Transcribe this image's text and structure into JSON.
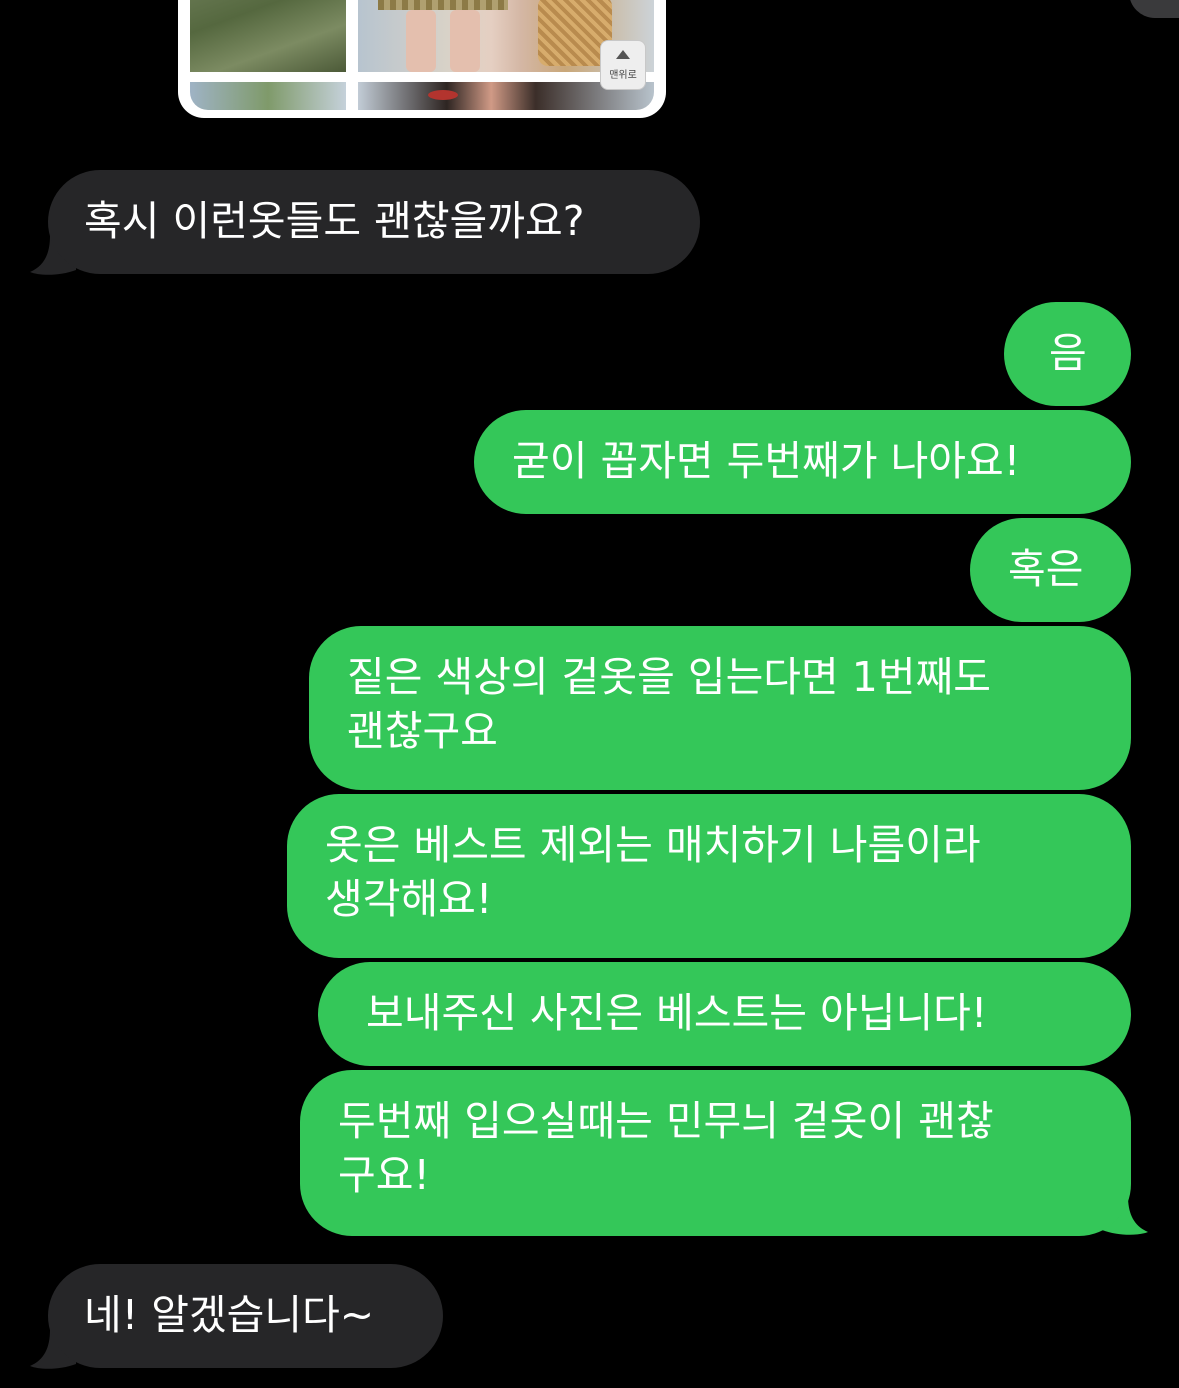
{
  "attachment": {
    "scroll_top_button_label": "맨위로"
  },
  "messages": [
    {
      "id": "m1",
      "from": "them",
      "text": "혹시 이런옷들도 괜찮을까요?"
    },
    {
      "id": "m2",
      "from": "me",
      "text": "음"
    },
    {
      "id": "m3",
      "from": "me",
      "text": "굳이 꼽자면 두번째가 나아요!"
    },
    {
      "id": "m4",
      "from": "me",
      "text": "혹은"
    },
    {
      "id": "m5",
      "from": "me",
      "lines": [
        "짙은 색상의 겉옷을 입는다면 1번째도",
        "괜찮구요"
      ]
    },
    {
      "id": "m6",
      "from": "me",
      "lines": [
        "옷은 베스트 제외는 매치하기 나름이라",
        "생각해요!"
      ]
    },
    {
      "id": "m7",
      "from": "me",
      "text": "보내주신 사진은 베스트는 아닙니다!"
    },
    {
      "id": "m8",
      "from": "me",
      "lines": [
        "두번째 입으실때는 민무늬 겉옷이 괜찮",
        "구요!"
      ]
    },
    {
      "id": "m9",
      "from": "them",
      "text": "네! 알겠습니다~"
    }
  ],
  "colors": {
    "background": "#000000",
    "received_bubble": "#262628",
    "sent_bubble": "#34c759",
    "text": "#ffffff"
  }
}
